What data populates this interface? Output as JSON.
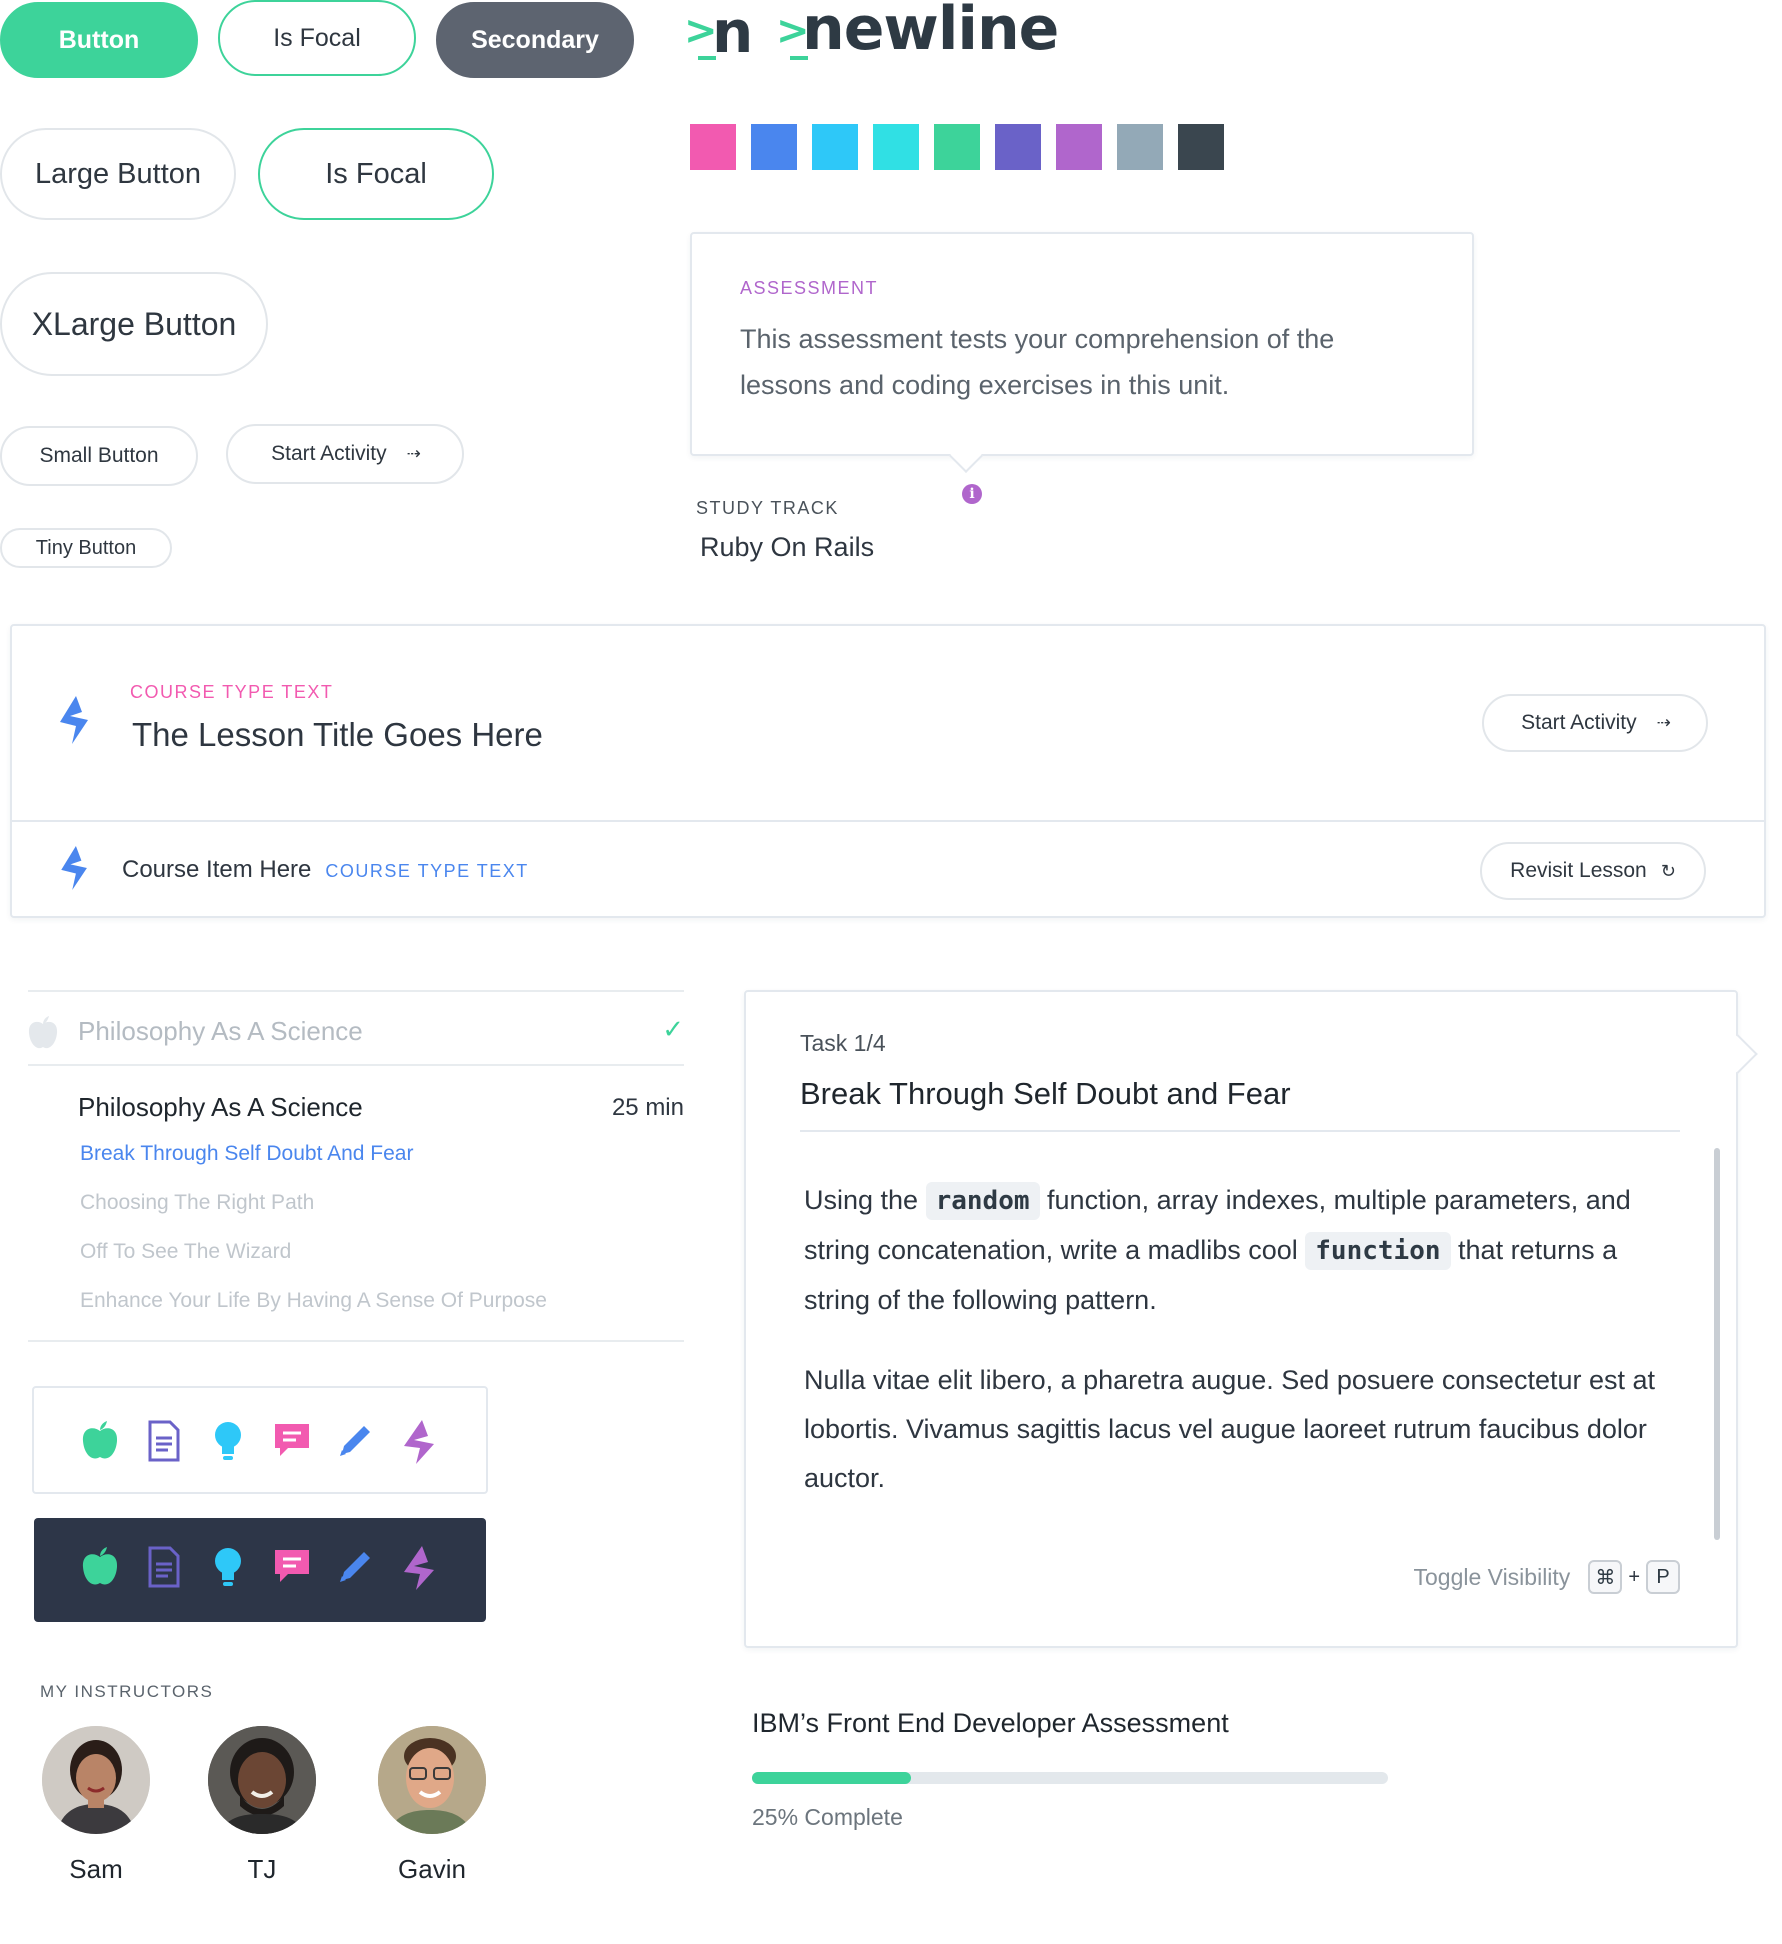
{
  "buttons": {
    "button": "Button",
    "is_focal": "Is Focal",
    "secondary": "Secondary",
    "large": "Large Button",
    "large_focal": "Is Focal",
    "xlarge": "XLarge Button",
    "small": "Small Button",
    "start_activity": "Start Activity",
    "tiny": "Tiny Button"
  },
  "logo": {
    "short": "n",
    "full": "newline",
    "chevron": ">"
  },
  "swatches": [
    "#f25ab0",
    "#4a86ee",
    "#2ec8f8",
    "#30e0e4",
    "#3dd39a",
    "#6a62c8",
    "#b066cc",
    "#93a9b7",
    "#3a464f"
  ],
  "assessment": {
    "label": "ASSESSMENT",
    "text": "This assessment tests your comprehension of the lessons and coding exercises in this unit."
  },
  "study_track": {
    "label": "STUDY TRACK",
    "value": "Ruby On Rails"
  },
  "lesson_card": {
    "type_text": "COURSE TYPE TEXT",
    "title": "The Lesson Title Goes Here",
    "button": "Start Activity"
  },
  "course_item": {
    "title": "Course Item Here",
    "type_text": "COURSE TYPE TEXT",
    "button": "Revisit Lesson"
  },
  "module": {
    "completed_title": "Philosophy As A Science",
    "current_title": "Philosophy As A Science",
    "duration": "25 min",
    "lessons": [
      {
        "label": "Break Through Self Doubt And Fear",
        "state": "active"
      },
      {
        "label": "Choosing The Right Path",
        "state": "upcoming"
      },
      {
        "label": "Off To See The Wizard",
        "state": "upcoming"
      },
      {
        "label": "Enhance Your Life By Having A Sense Of Purpose",
        "state": "upcoming"
      }
    ]
  },
  "icon_rows": {
    "icons": [
      "apple-icon",
      "document-icon",
      "lightbulb-icon",
      "chat-icon",
      "pencil-icon",
      "lightning-icon"
    ],
    "colors": [
      "#3dd39a",
      "#6a62c8",
      "#2ec8f8",
      "#f25ab0",
      "#4a86ee",
      "#b066cc"
    ]
  },
  "instructors": {
    "label": "MY INSTRUCTORS",
    "people": [
      {
        "name": "Sam"
      },
      {
        "name": "TJ"
      },
      {
        "name": "Gavin"
      }
    ]
  },
  "task": {
    "counter": "Task 1/4",
    "title": "Break Through Self Doubt and Fear",
    "p1_a": "Using the",
    "code1": "random",
    "p1_b": "function, array indexes, multiple parameters, and string concatenation, write a madlibs cool",
    "code2": "function",
    "p1_c": "that returns a string of the following pattern.",
    "p2": "Nulla vitae elit libero, a pharetra augue. Sed posuere consectetur est at lobortis. Vivamus sagittis lacus vel augue laoreet rutrum faucibus dolor auctor.",
    "toggle_label": "Toggle Visibility",
    "key1": "⌘",
    "plus": "+",
    "key2": "P"
  },
  "progress": {
    "title": "IBM’s Front End Developer Assessment",
    "percent": 25,
    "label": "25% Complete"
  },
  "colors": {
    "accent_green": "#3dd39a",
    "accent_blue": "#4a86ee",
    "accent_pink": "#f25ab0",
    "accent_purple": "#b066cc",
    "dark_panel": "#2d3648"
  }
}
